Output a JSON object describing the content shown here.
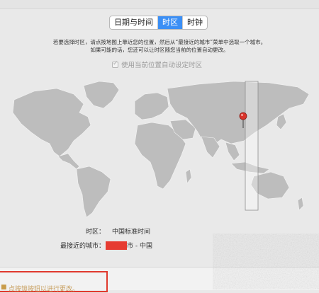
{
  "tabs": [
    {
      "label": "日期与时间",
      "active": false
    },
    {
      "label": "时区",
      "active": true
    },
    {
      "label": "时钟",
      "active": false
    }
  ],
  "instructions": {
    "line1": "若要选择时区，请点按地图上靠近您的位置，然后从“最接近的城市”菜单中选取一个城市。",
    "line2": "如果可能的话，您还可以让时区随您当前的位置自动更改。"
  },
  "auto_timezone": {
    "label": "使用当前位置自动设定时区",
    "checked": true
  },
  "timezone": {
    "label": "时区：",
    "value": "中国标准时间"
  },
  "closest_city": {
    "label": "最接近的城市：",
    "suffix": "市 - 中国"
  },
  "lock": {
    "text": "点按锁按钮以进行更改。"
  },
  "colors": {
    "accent": "#3b8ff5",
    "highlight": "#e03a2e",
    "land": "#bdbdbd"
  },
  "icons": [
    "map-pin-icon",
    "lock-icon",
    "check-icon"
  ]
}
